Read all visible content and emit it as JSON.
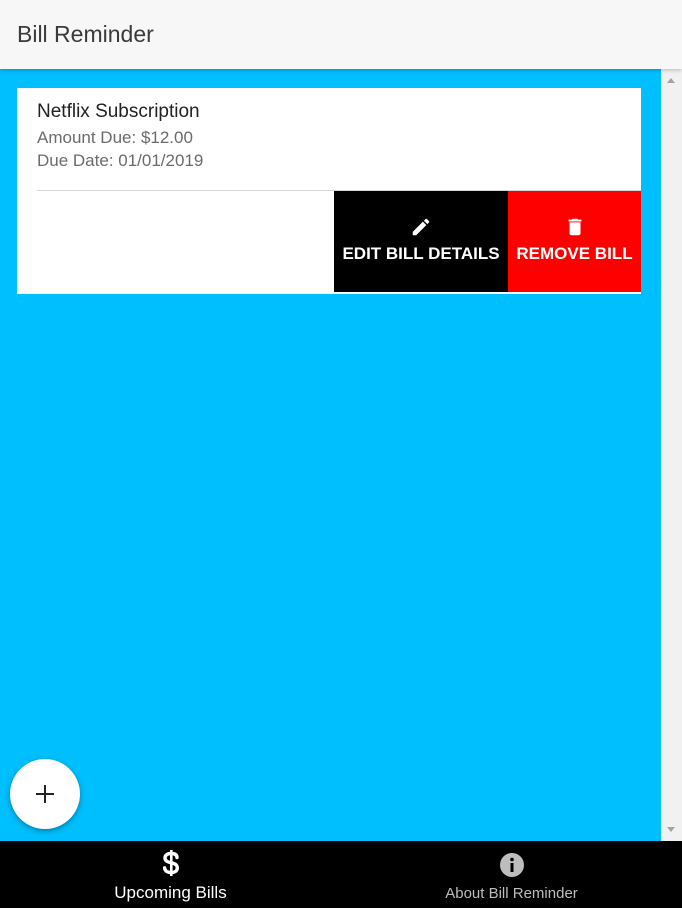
{
  "header": {
    "title": "Bill Reminder"
  },
  "bills": [
    {
      "name": "Netflix Subscription",
      "amount_text": "Amount Due: $12.00",
      "due_text": "Due Date: 01/01/2019",
      "edit_label": "EDIT BILL DETAILS",
      "remove_label": "REMOVE BILL",
      "edit_icon": "pencil-icon",
      "remove_icon": "trash-icon"
    }
  ],
  "fab": {
    "icon": "plus-icon"
  },
  "bottom_nav": {
    "items": [
      {
        "label": "Upcoming Bills",
        "icon": "dollar-icon",
        "active": true
      },
      {
        "label": "About Bill Reminder",
        "icon": "info-icon",
        "active": false
      }
    ]
  },
  "colors": {
    "content_background": "#00bfff",
    "edit_button": "#000000",
    "remove_button": "#ff0000",
    "bottom_nav": "#000000",
    "header": "#f7f7f7"
  }
}
